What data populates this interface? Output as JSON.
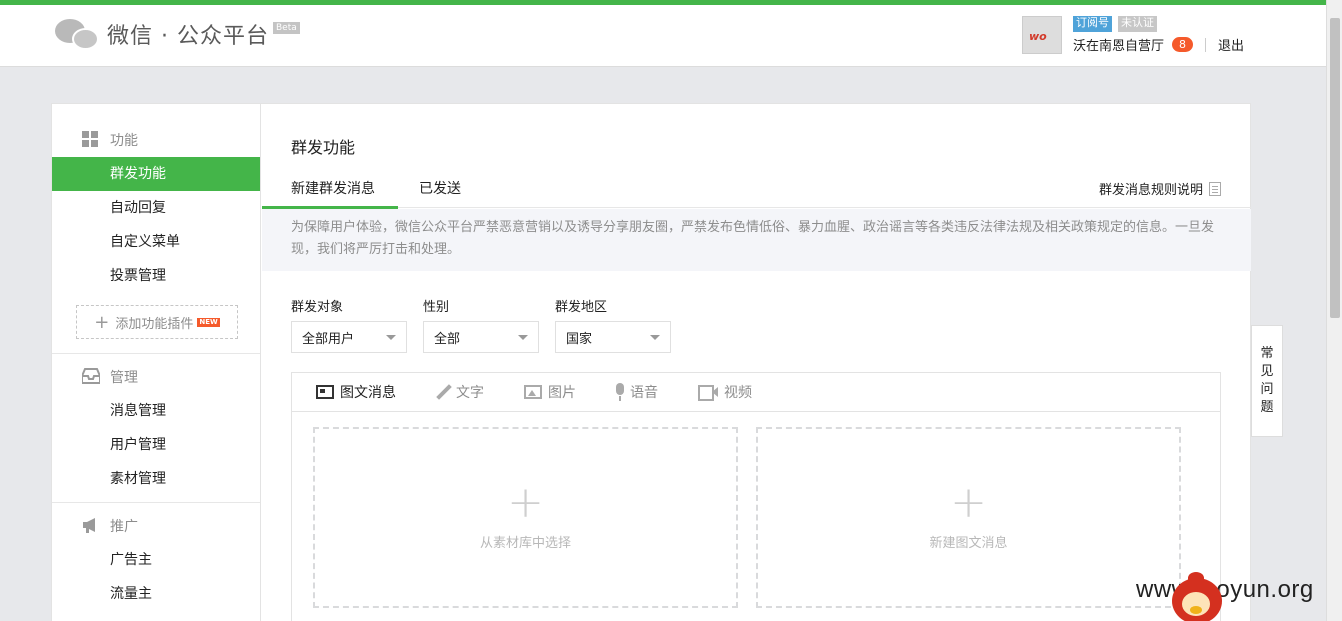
{
  "header": {
    "logo_text": "微信 · 公众平台",
    "beta_label": "Beta",
    "account": {
      "avatar_text": "wo",
      "type_badge": "订阅号",
      "verify_badge": "未认证",
      "name": "沃在南恩自营厅",
      "message_count": "8",
      "logout_label": "退出"
    }
  },
  "sidebar": {
    "groups": [
      {
        "title": "功能",
        "icon": "grid-icon",
        "items": [
          {
            "label": "群发功能",
            "active": true
          },
          {
            "label": "自动回复"
          },
          {
            "label": "自定义菜单"
          },
          {
            "label": "投票管理"
          }
        ],
        "add_plugin_label": "添加功能插件",
        "new_tag": "NEW"
      },
      {
        "title": "管理",
        "icon": "inbox-icon",
        "items": [
          {
            "label": "消息管理"
          },
          {
            "label": "用户管理"
          },
          {
            "label": "素材管理"
          }
        ]
      },
      {
        "title": "推广",
        "icon": "megaphone-icon",
        "items": [
          {
            "label": "广告主"
          },
          {
            "label": "流量主"
          }
        ]
      }
    ]
  },
  "main": {
    "page_title": "群发功能",
    "tabs": [
      {
        "label": "新建群发消息",
        "active": true
      },
      {
        "label": "已发送"
      }
    ],
    "rule_link": "群发消息规则说明",
    "notice": "为保障用户体验，微信公众平台严禁恶意营销以及诱导分享朋友圈，严禁发布色情低俗、暴力血腥、政治谣言等各类违反法律法规及相关政策规定的信息。一旦发现，我们将严厉打击和处理。",
    "filters": [
      {
        "label": "群发对象",
        "value": "全部用户"
      },
      {
        "label": "性别",
        "value": "全部"
      },
      {
        "label": "群发地区",
        "value": "国家"
      }
    ],
    "media_tabs": [
      {
        "label": "图文消息",
        "icon": "news-icon",
        "active": true
      },
      {
        "label": "文字",
        "icon": "pen-icon"
      },
      {
        "label": "图片",
        "icon": "image-icon"
      },
      {
        "label": "语音",
        "icon": "mic-icon"
      },
      {
        "label": "视频",
        "icon": "video-icon"
      }
    ],
    "slots": [
      {
        "label": "从素材库中选择"
      },
      {
        "label": "新建图文消息"
      }
    ]
  },
  "faq": {
    "chars": [
      "常",
      "见",
      "问",
      "题"
    ]
  },
  "watermark": {
    "text": "www.    ooyun.org"
  },
  "colors": {
    "accent_green": "#44b549",
    "badge_blue": "#4fa3d9",
    "count_orange": "#f55a2b"
  }
}
